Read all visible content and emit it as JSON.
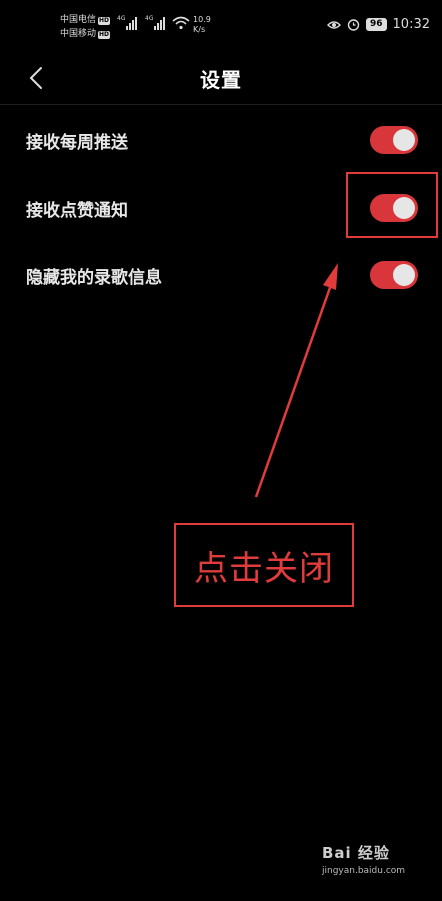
{
  "status_bar": {
    "carrier1": "中国电信",
    "carrier2": "中国移动",
    "hd_badge": "HD",
    "net_type": "4G",
    "speed_value": "10.9",
    "speed_unit": "K/s",
    "battery": "96",
    "time": "10:32"
  },
  "header": {
    "title": "设置"
  },
  "settings": [
    {
      "label": "接收每周推送",
      "enabled": true
    },
    {
      "label": "接收点赞通知",
      "enabled": true
    },
    {
      "label": "隐藏我的录歌信息",
      "enabled": true
    }
  ],
  "annotation": {
    "note": "点击关闭",
    "color": "#e23b3b"
  },
  "watermark": {
    "logo": "Bai 经验",
    "url": "jingyan.baidu.com"
  },
  "colors": {
    "background": "#000000",
    "toggle_on": "#d8363a",
    "annotation": "#e23b3b"
  }
}
